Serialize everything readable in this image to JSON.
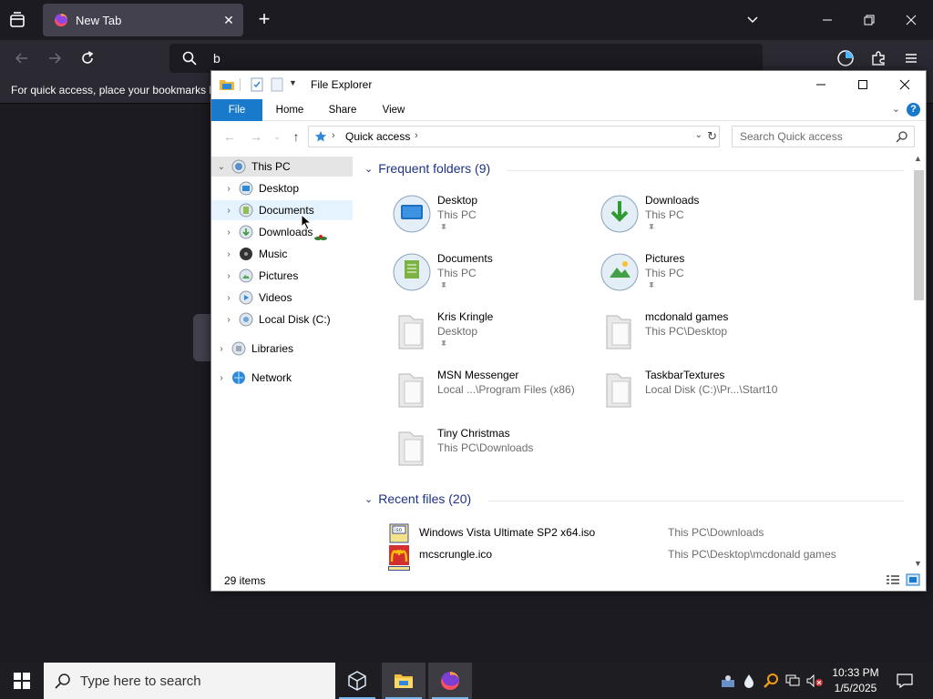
{
  "firefox": {
    "tab": {
      "title": "New Tab",
      "close_icon": "close-icon"
    },
    "urlbar": {
      "text": "b"
    },
    "bookmarks_text": "For quick access, place your bookmarks h"
  },
  "explorer": {
    "title": "File Explorer",
    "ribbon": {
      "file": "File",
      "home": "Home",
      "share": "Share",
      "view": "View"
    },
    "address": {
      "location": "Quick access"
    },
    "search": {
      "placeholder": "Search Quick access"
    },
    "nav": {
      "this_pc": "This PC",
      "items": [
        "Desktop",
        "Documents",
        "Downloads",
        "Music",
        "Pictures",
        "Videos",
        "Local Disk (C:)"
      ],
      "libraries": "Libraries",
      "network": "Network"
    },
    "frequent": {
      "header": "Frequent folders (9)",
      "folders": [
        {
          "name": "Desktop",
          "path": "This PC",
          "pinned": true
        },
        {
          "name": "Downloads",
          "path": "This PC",
          "pinned": true
        },
        {
          "name": "Documents",
          "path": "This PC",
          "pinned": true
        },
        {
          "name": "Pictures",
          "path": "This PC",
          "pinned": true
        },
        {
          "name": "Kris Kringle",
          "path": "Desktop",
          "pinned": true
        },
        {
          "name": "mcdonald games",
          "path": "This PC\\Desktop",
          "pinned": false
        },
        {
          "name": "MSN Messenger",
          "path": "Local ...\\Program Files (x86)",
          "pinned": false
        },
        {
          "name": "TaskbarTextures",
          "path": "Local Disk (C:)\\Pr...\\Start10",
          "pinned": false
        },
        {
          "name": "Tiny Christmas",
          "path": "This PC\\Downloads",
          "pinned": false
        }
      ]
    },
    "recent": {
      "header": "Recent files (20)",
      "files": [
        {
          "name": "Windows Vista Ultimate SP2 x64.iso",
          "path": "This PC\\Downloads"
        },
        {
          "name": "mcscrungle.ico",
          "path": "This PC\\Desktop\\mcdonald games"
        }
      ]
    },
    "status": "29 items"
  },
  "taskbar": {
    "search_placeholder": "Type here to search",
    "time": "10:33 PM",
    "date": "1/5/2025"
  },
  "colors": {
    "accent": "#1979ca",
    "group_header": "#1e3287",
    "taskbar": "#1e1e22",
    "firefox_bg": "#1c1b22"
  }
}
